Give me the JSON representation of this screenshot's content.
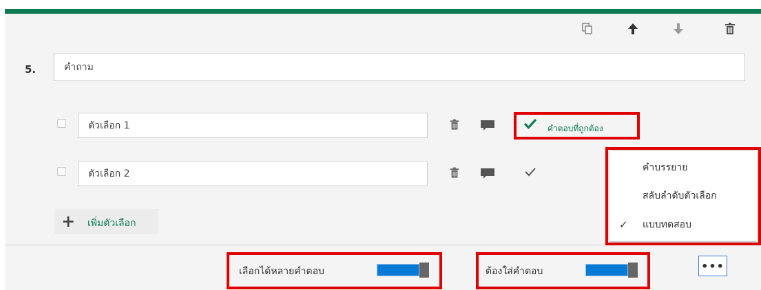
{
  "question": {
    "number": "5.",
    "text": "คำถาม"
  },
  "options": [
    {
      "label": "ตัวเลือก 1",
      "is_correct": true
    },
    {
      "label": "ตัวเลือก 2",
      "is_correct": false
    }
  ],
  "correct_answer_label": "คำตอบที่ถูกต้อง",
  "add_option_label": "เพิ่มตัวเลือก",
  "more_menu": {
    "items": [
      {
        "label": "คำบรรยาย",
        "checked": false
      },
      {
        "label": "สลับลำดับตัวเลือก",
        "checked": false
      },
      {
        "label": "แบบทดสอบ",
        "checked": true
      }
    ],
    "check_glyph": "✓"
  },
  "footer": {
    "multiple_answers_label": "เลือกได้หลายคำตอบ",
    "multiple_answers_on": true,
    "required_label": "ต้องใส่คำตอบ",
    "required_on": true,
    "more_button_label": "•••"
  },
  "icons": {
    "toolbar": [
      "copy-icon",
      "move-up-icon",
      "move-down-icon",
      "delete-icon"
    ],
    "option_row": [
      "delete-icon",
      "comment-icon",
      "checkmark-icon"
    ]
  },
  "colors": {
    "accent": "#0f7b55",
    "highlight": "#e00000",
    "toggle_on": "#0a7ad6"
  }
}
